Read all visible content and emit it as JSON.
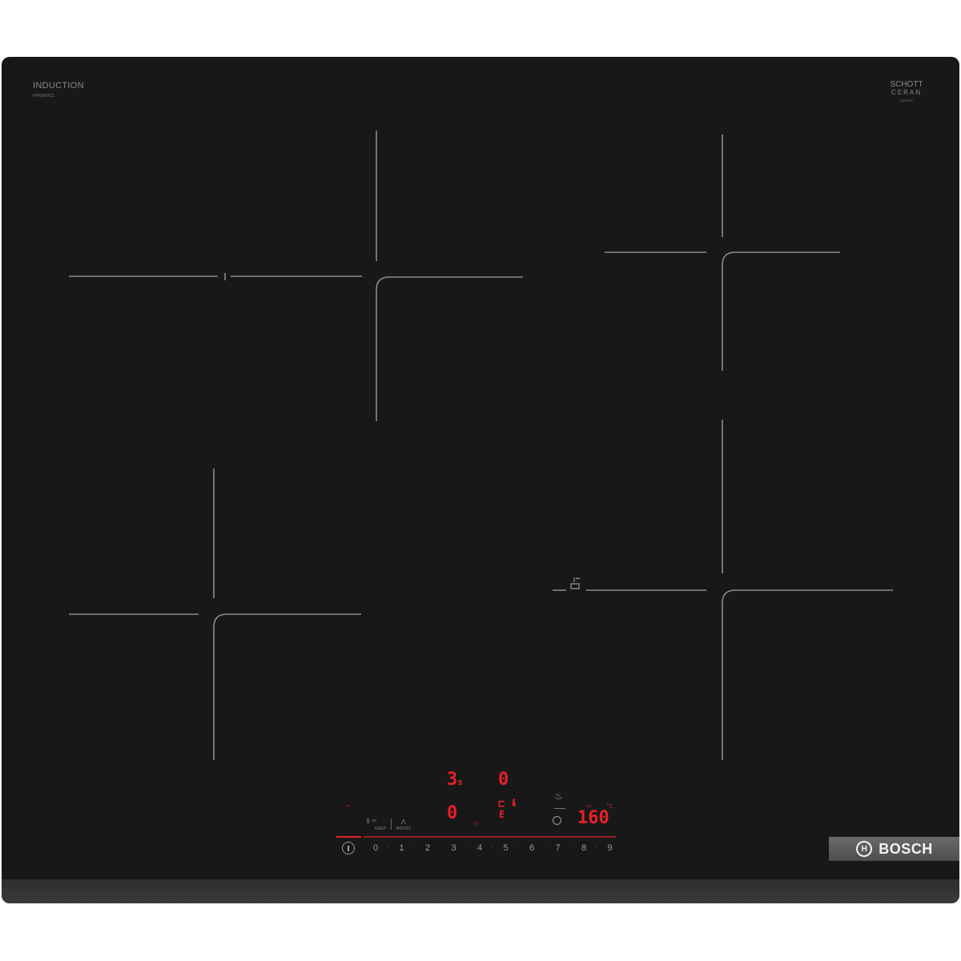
{
  "panel": {
    "title": "INDUCTION",
    "model": "PIF63RHC1",
    "glass_brand_line1": "SCHOTT",
    "glass_brand_line2": "CERAN",
    "glass_brand_code": "0007005"
  },
  "displays": {
    "top_left": "3",
    "top_left_sub": "s",
    "top_right": "0",
    "bottom_left": "0",
    "temperature": "160",
    "temperature_unit": "°C"
  },
  "controls": {
    "boost_label": "BOOST",
    "keep_warm_label": "KEEP",
    "scale": [
      "0",
      "1",
      "2",
      "3",
      "4",
      "5",
      "6",
      "7",
      "8",
      "9"
    ]
  },
  "brand": {
    "name": "BOSCH"
  },
  "colors": {
    "glass": "#181818",
    "display": "#e8202a",
    "line": "#8c8c8c"
  }
}
